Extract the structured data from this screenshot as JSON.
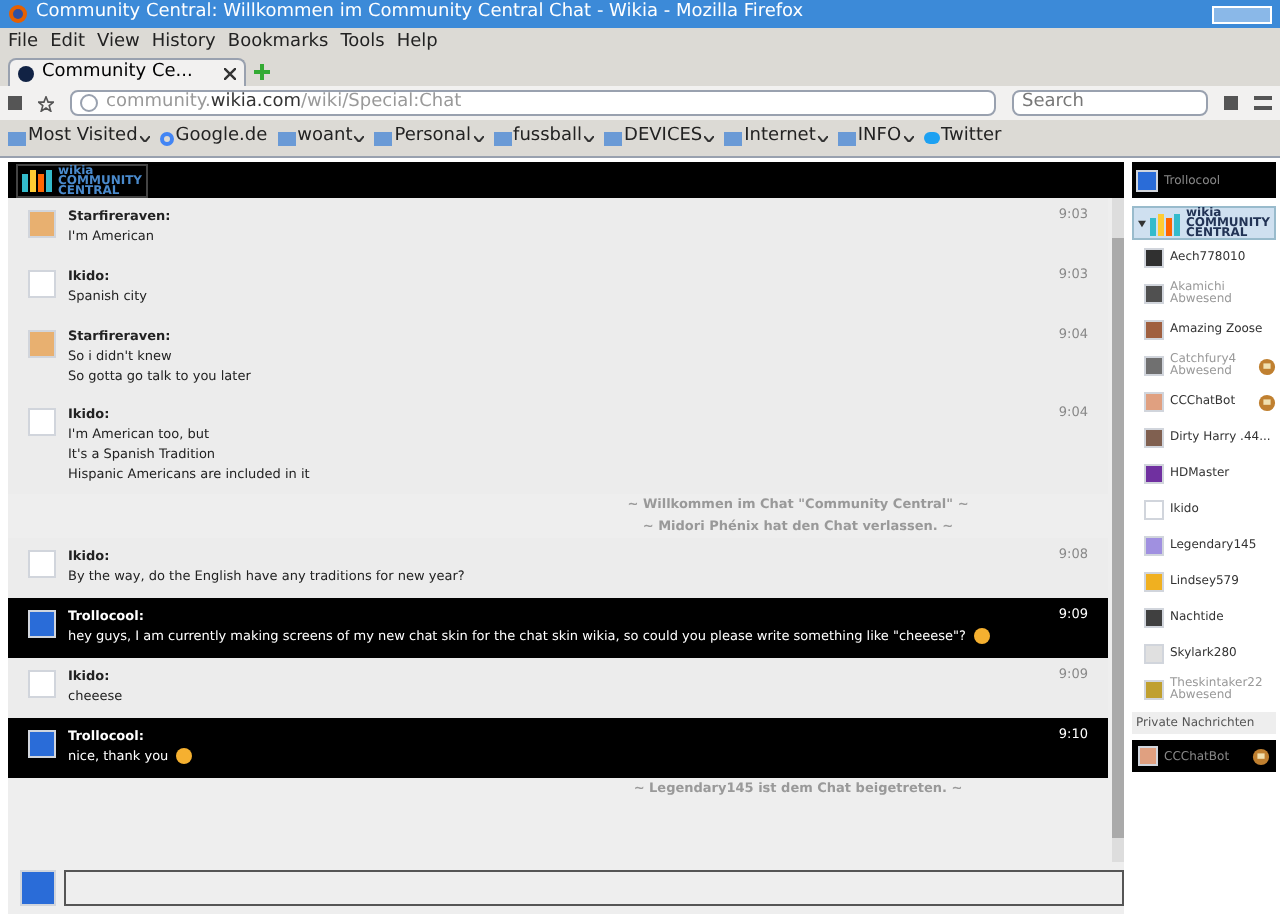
{
  "window": {
    "title": "Community Central: Willkommen im Community Central Chat - Wikia - Mozilla Firefox"
  },
  "menu": [
    "File",
    "Edit",
    "View",
    "History",
    "Bookmarks",
    "Tools",
    "Help"
  ],
  "tabs": [
    {
      "label": "Community Ce...",
      "selected": true
    }
  ],
  "url": {
    "host": "community.",
    "domain": "wikia.com",
    "path": "/wiki/Special:Chat"
  },
  "search": {
    "placeholder": "Search"
  },
  "bookmarks": [
    {
      "label": "Most Visited",
      "kind": "folder",
      "menu": true
    },
    {
      "label": "Google.de",
      "kind": "google",
      "menu": false
    },
    {
      "label": "woant",
      "kind": "folder",
      "menu": true
    },
    {
      "label": "Personal",
      "kind": "folder",
      "menu": true
    },
    {
      "label": "fussball",
      "kind": "folder",
      "menu": true
    },
    {
      "label": "DEVICES",
      "kind": "folder",
      "menu": true
    },
    {
      "label": "Internet",
      "kind": "folder",
      "menu": true
    },
    {
      "label": "INFO",
      "kind": "folder",
      "menu": true
    },
    {
      "label": "Twitter",
      "kind": "twitter",
      "menu": false
    }
  ],
  "chat": {
    "logo_lines": [
      "wikia",
      "COMMUNITY",
      "CENTRAL"
    ],
    "current_user": "Trollocool",
    "messages": [
      {
        "kind": "message",
        "user": "Starfireraven:",
        "color": "#e8b070",
        "lines": [
          "I'm American"
        ],
        "time": "9:03",
        "highlight": false,
        "emoji": false
      },
      {
        "kind": "message",
        "user": "Ikido:",
        "color": "#ffffff",
        "lines": [
          "Spanish city"
        ],
        "time": "9:03",
        "highlight": false,
        "emoji": false
      },
      {
        "kind": "message",
        "user": "Starfireraven:",
        "color": "#e8b070",
        "lines": [
          "So i didn't knew",
          "So gotta go talk to you later"
        ],
        "time": "9:04",
        "highlight": false,
        "emoji": false
      },
      {
        "kind": "message",
        "user": "Ikido:",
        "color": "#ffffff",
        "lines": [
          "I'm American too, but",
          "It's a Spanish Tradition",
          "Hispanic Americans are included in it"
        ],
        "time": "9:04",
        "highlight": false,
        "emoji": false
      },
      {
        "kind": "system",
        "text": "~ Willkommen im Chat \"Community Central\" ~"
      },
      {
        "kind": "system",
        "text": "~ Midori Phénix hat den Chat verlassen. ~"
      },
      {
        "kind": "message",
        "user": "Ikido:",
        "color": "#ffffff",
        "lines": [
          "By the way, do the English have any traditions for new year?"
        ],
        "time": "9:08",
        "highlight": false,
        "emoji": false
      },
      {
        "kind": "message",
        "user": "Trollocool:",
        "color": "#2a6cd8",
        "lines": [
          "hey guys, I am currently making screens of my new chat skin for the chat skin wikia, so could you please write something like \"cheeese\"?"
        ],
        "time": "9:09",
        "highlight": true,
        "emoji": true
      },
      {
        "kind": "message",
        "user": "Ikido:",
        "color": "#ffffff",
        "lines": [
          "cheeese"
        ],
        "time": "9:09",
        "highlight": false,
        "emoji": false
      },
      {
        "kind": "message",
        "user": "Trollocool:",
        "color": "#2a6cd8",
        "lines": [
          "nice, thank you"
        ],
        "time": "9:10",
        "highlight": true,
        "emoji": true
      },
      {
        "kind": "system",
        "text": "~ Legendary145 ist dem Chat beigetreten. ~"
      }
    ]
  },
  "room": {
    "logo_lines": [
      "wikia",
      "COMMUNITY",
      "CENTRAL"
    ],
    "expanded": true
  },
  "users": [
    {
      "name": "Aech778010",
      "color": "#303030",
      "away": false,
      "mod": false
    },
    {
      "name": "Akamichi",
      "color": "#505050",
      "away": true,
      "status": "Abwesend",
      "mod": false
    },
    {
      "name": "Amazing Zoose",
      "color": "#a06040",
      "away": false,
      "mod": false
    },
    {
      "name": "Catchfury4",
      "color": "#707070",
      "away": true,
      "status": "Abwesend",
      "mod": true
    },
    {
      "name": "CCChatBot",
      "color": "#e0a080",
      "away": false,
      "mod": true
    },
    {
      "name": "Dirty Harry .44...",
      "color": "#806050",
      "away": false,
      "mod": false
    },
    {
      "name": "HDMaster",
      "color": "#7030a0",
      "away": false,
      "mod": false
    },
    {
      "name": "Ikido",
      "color": "#ffffff",
      "away": false,
      "mod": false
    },
    {
      "name": "Legendary145",
      "color": "#a090e0",
      "away": false,
      "mod": false
    },
    {
      "name": "Lindsey579",
      "color": "#f0b020",
      "away": false,
      "mod": false
    },
    {
      "name": "Nachtide",
      "color": "#404040",
      "away": false,
      "mod": false
    },
    {
      "name": "Skylark280",
      "color": "#e0e0e0",
      "away": false,
      "mod": false
    },
    {
      "name": "Theskintaker22",
      "color": "#c0a030",
      "away": true,
      "status": "Abwesend",
      "mod": false
    }
  ],
  "private": {
    "heading": "Private Nachrichten",
    "items": [
      {
        "name": "CCChatBot",
        "color": "#e0a080",
        "mod": true
      }
    ]
  }
}
